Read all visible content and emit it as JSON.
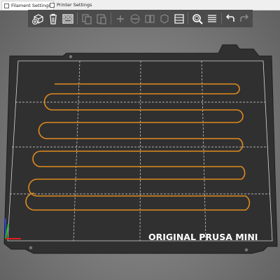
{
  "tabs": [
    {
      "label": "Filament Settings"
    },
    {
      "label": "Printer Settings"
    }
  ],
  "toolbar": {
    "buttons": [
      "add-icon",
      "delete-icon",
      "arrange-icon",
      "copy-icon",
      "paste-icon",
      "more-instances-icon",
      "fewer-instances-icon",
      "split-icon",
      "layers-icon",
      "search-icon",
      "variable-layer-height-icon",
      "undo-icon",
      "redo-icon"
    ]
  },
  "bed": {
    "label": "ORIGINAL PRUSA MINI",
    "colors": {
      "bed": "#303030",
      "grid": "#d8d8d8",
      "toolpath": "#e08a1e",
      "axis_x": "#d22",
      "axis_y": "#2b2",
      "axis_z": "#22d"
    }
  }
}
